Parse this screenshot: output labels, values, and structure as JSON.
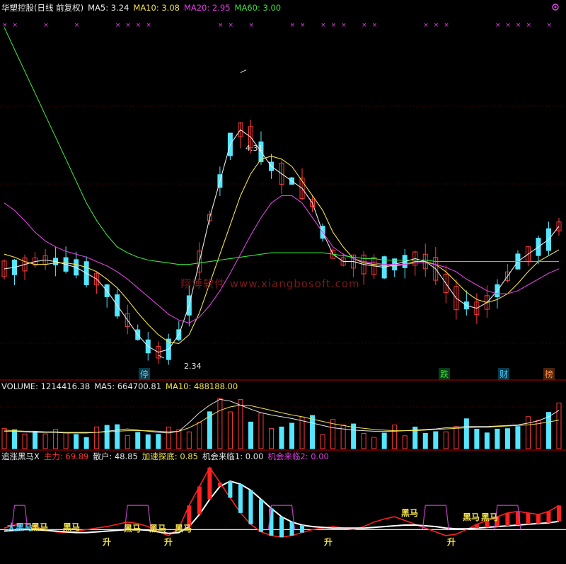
{
  "header": {
    "title": "华塑控股(日线 前复权)",
    "ma5": "MA5: 3.24",
    "ma10": "MA10: 3.08",
    "ma20": "MA20: 2.95",
    "ma60": "MA60: 3.00"
  },
  "volume_header": {
    "volume": "VOLUME: 1214416.38",
    "ma5": "MA5: 664700.81",
    "ma10": "MA10: 488188.00"
  },
  "indicator_header": {
    "name": "追涨黑马X",
    "main": "主力: 69.89",
    "retail": "散户: 48.85",
    "accel": "加速探底: 0.85",
    "chance1": "机会来临1: 0.00",
    "chance2": "机会来临2: 0.00"
  },
  "annotations": {
    "high": "4.31",
    "low": "2.34"
  },
  "watermark": "翔博软件 www.xiangbosoft.com",
  "event_tags": [
    {
      "text": "停",
      "color": "#4fd0ff"
    },
    {
      "text": "跌",
      "color": "#3ce23c"
    },
    {
      "text": "财",
      "color": "#4fd0ff"
    },
    {
      "text": "榜",
      "color": "#ff8a3c"
    }
  ],
  "signals": {
    "big_horse": "大黑马",
    "horse": "黑马",
    "rise": "升"
  },
  "colors": {
    "up": "#ff3b3b",
    "down": "#54e6ff",
    "ma5": "#e8e8e8",
    "ma10": "#f2e24a",
    "ma20": "#e040e0",
    "ma60": "#3ce23c",
    "grid": "#b00000"
  },
  "chart_data": [
    {
      "type": "candlestick",
      "series": [
        {
          "name": "MA5",
          "values": [
            2.95,
            2.96,
            2.98,
            3.0,
            3.01,
            3.0,
            2.98,
            2.96,
            2.92,
            2.88,
            2.8,
            2.7,
            2.6,
            2.5,
            2.42,
            2.38,
            2.4,
            2.5,
            2.7,
            3.0,
            3.3,
            3.55,
            3.8,
            3.9,
            3.85,
            3.75,
            3.65,
            3.6,
            3.55,
            3.5,
            3.4,
            3.2,
            3.05,
            3.0,
            3.0,
            2.98,
            2.97,
            2.96,
            2.98,
            3.0,
            3.02,
            3.0,
            2.95,
            2.85,
            2.75,
            2.7,
            2.68,
            2.72,
            2.8,
            2.9,
            3.0,
            3.05,
            3.1,
            3.15,
            3.24
          ]
        },
        {
          "name": "MA10",
          "values": [
            3.05,
            3.03,
            3.0,
            2.98,
            2.98,
            2.99,
            2.99,
            2.98,
            2.96,
            2.93,
            2.88,
            2.82,
            2.74,
            2.65,
            2.57,
            2.5,
            2.45,
            2.44,
            2.5,
            2.65,
            2.85,
            3.05,
            3.25,
            3.45,
            3.6,
            3.7,
            3.72,
            3.7,
            3.65,
            3.55,
            3.45,
            3.35,
            3.2,
            3.1,
            3.02,
            2.99,
            2.98,
            2.97,
            2.97,
            2.98,
            3.0,
            3.0,
            2.98,
            2.93,
            2.86,
            2.79,
            2.74,
            2.72,
            2.74,
            2.78,
            2.85,
            2.93,
            3.0,
            3.04,
            3.08
          ]
        },
        {
          "name": "MA20",
          "values": [
            3.4,
            3.35,
            3.28,
            3.2,
            3.14,
            3.1,
            3.07,
            3.05,
            3.03,
            3.0,
            2.97,
            2.93,
            2.88,
            2.82,
            2.76,
            2.7,
            2.64,
            2.6,
            2.58,
            2.62,
            2.7,
            2.8,
            2.92,
            3.05,
            3.18,
            3.3,
            3.4,
            3.45,
            3.45,
            3.4,
            3.3,
            3.2,
            3.1,
            3.05,
            3.02,
            3.0,
            2.99,
            2.98,
            2.98,
            2.98,
            2.99,
            2.99,
            2.98,
            2.96,
            2.93,
            2.88,
            2.84,
            2.8,
            2.78,
            2.78,
            2.8,
            2.84,
            2.88,
            2.92,
            2.95
          ]
        },
        {
          "name": "MA60",
          "values": [
            4.6,
            4.45,
            4.3,
            4.15,
            4.0,
            3.85,
            3.7,
            3.55,
            3.4,
            3.28,
            3.18,
            3.1,
            3.06,
            3.03,
            3.01,
            3.0,
            2.99,
            2.98,
            2.98,
            2.99,
            3.0,
            3.01,
            3.02,
            3.03,
            3.04,
            3.05,
            3.06,
            3.06,
            3.06,
            3.06,
            3.06,
            3.06,
            3.05,
            3.04,
            3.03,
            3.02,
            3.02,
            3.01,
            3.01,
            3.01,
            3.01,
            3.01,
            3.0,
            3.0,
            3.0,
            3.0,
            3.0,
            3.0,
            3.0,
            3.0,
            3.0,
            3.0,
            3.0,
            3.0,
            3.0
          ]
        }
      ],
      "high": 4.31,
      "low": 2.34,
      "ylim": [
        2.2,
        4.7
      ]
    },
    {
      "type": "bar",
      "title": "VOLUME",
      "series": [
        {
          "name": "MA5",
          "values": [
            0.3,
            0.3,
            0.29,
            0.28,
            0.28,
            0.28,
            0.27,
            0.27,
            0.27,
            0.28,
            0.3,
            0.32,
            0.34,
            0.32,
            0.3,
            0.28,
            0.27,
            0.3,
            0.45,
            0.62,
            0.75,
            0.85,
            0.82,
            0.75,
            0.68,
            0.62,
            0.58,
            0.55,
            0.52,
            0.48,
            0.44,
            0.4,
            0.36,
            0.34,
            0.32,
            0.31,
            0.3,
            0.3,
            0.3,
            0.31,
            0.32,
            0.33,
            0.34,
            0.36,
            0.37,
            0.38,
            0.38,
            0.38,
            0.39,
            0.4,
            0.41,
            0.44,
            0.48,
            0.55,
            0.66
          ]
        },
        {
          "name": "MA10",
          "values": [
            0.32,
            0.31,
            0.3,
            0.3,
            0.29,
            0.29,
            0.28,
            0.28,
            0.28,
            0.28,
            0.29,
            0.3,
            0.31,
            0.31,
            0.31,
            0.3,
            0.29,
            0.3,
            0.36,
            0.45,
            0.56,
            0.66,
            0.72,
            0.75,
            0.74,
            0.7,
            0.66,
            0.62,
            0.58,
            0.55,
            0.51,
            0.47,
            0.43,
            0.4,
            0.37,
            0.35,
            0.33,
            0.32,
            0.31,
            0.31,
            0.31,
            0.32,
            0.33,
            0.34,
            0.35,
            0.36,
            0.37,
            0.37,
            0.38,
            0.39,
            0.4,
            0.41,
            0.43,
            0.46,
            0.49
          ]
        }
      ]
    },
    {
      "type": "line",
      "title": "追涨黑马X",
      "series": [
        {
          "name": "主力",
          "values": [
            40,
            44,
            46,
            42,
            38,
            35,
            34,
            36,
            38,
            40,
            42,
            45,
            48,
            46,
            42,
            35,
            30,
            40,
            70,
            95,
            120,
            100,
            80,
            60,
            45,
            35,
            30,
            28,
            30,
            34,
            38,
            40,
            42,
            40,
            38,
            42,
            48,
            52,
            55,
            50,
            45,
            40,
            35,
            30,
            32,
            38,
            45,
            50,
            55,
            60,
            62,
            60,
            58,
            62,
            69.89
          ]
        },
        {
          "name": "散户",
          "values": [
            36,
            37,
            38,
            38,
            37,
            36,
            35,
            34,
            34,
            35,
            36,
            37,
            38,
            38,
            37,
            35,
            33,
            34,
            42,
            58,
            78,
            95,
            102,
            98,
            90,
            78,
            66,
            55,
            48,
            44,
            42,
            41,
            40,
            40,
            40,
            40,
            41,
            42,
            43,
            44,
            44,
            43,
            42,
            40,
            39,
            39,
            40,
            41,
            42,
            43,
            44,
            45,
            46,
            47,
            48.85
          ]
        }
      ]
    }
  ]
}
